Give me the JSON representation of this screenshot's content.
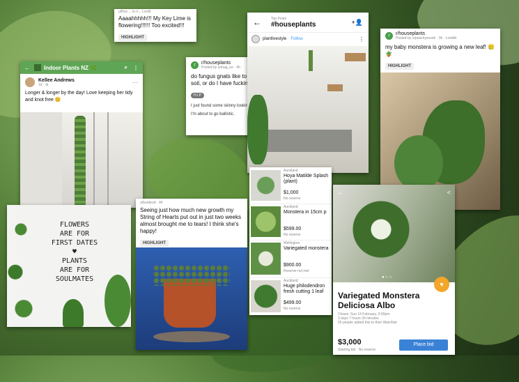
{
  "c1": {
    "meta": "u/Ros ... in r/... Lordit",
    "text": "Aaaahhhhh!!! My Key Lime is flowering!!!!!! Too excited!!!",
    "badge": "HIGHLIGHT"
  },
  "c2": {
    "group": "Indoor Plants NZ 🌿",
    "author": "Kellee Andrews",
    "time": "1d · ⚙",
    "text": "Longer & longer by the day! Love keeping her tidy and knot free 😊"
  },
  "c3": {
    "sub": "r/houseplants",
    "meta": "Posted by u/mag_ee · 4h",
    "title": "do fungus gnats like to crawl around in the soil, or do I have fucking thrips?",
    "flair": "H.I.P",
    "body1": "I just found some skinny looking shits in my orbifolia soil.",
    "body2": "I'm about to go ballistic."
  },
  "c4": {
    "top": "Top Posts",
    "tag": "#houseplants",
    "account": "plantlivestyle",
    "follow": "Follow"
  },
  "c5": {
    "sub": "r/houseplants",
    "meta": "Posted by u/peachysosoh · 3h · Lreddit",
    "text": "my baby monstera is growing a new leaf! 🥲🪴",
    "badge": "HIGHLIGHT"
  },
  "c6": {
    "lines": [
      "FLOWERS",
      "ARE FOR",
      "FIRST DATES",
      "♥",
      "PLANTS",
      "ARE FOR",
      "SOULMATES"
    ]
  },
  "c7": {
    "meta": "u/burdeod · 4h",
    "text": "Seeing just how much new growth my String of Hearts put out in just two weeks almost brought me to tears! I think she's happy!",
    "badge": "HIGHLIGHT"
  },
  "c8": {
    "items": [
      {
        "loc": "Auckland",
        "title": "Hoya Matilde Splash (plant)",
        "price": "$1,000",
        "note": "No reserve"
      },
      {
        "loc": "Auckland",
        "title": "Monstera in 15cm p",
        "price": "$599.00",
        "note": "No reserve"
      },
      {
        "loc": "Wellington",
        "title": "Variegated monstera",
        "price": "$900.00",
        "note": "Reserve not met"
      },
      {
        "loc": "Auckland",
        "title": "Huge philodendron fresh cutting 1 leaf",
        "price": "$499.00",
        "note": "No reserve"
      }
    ]
  },
  "c9": {
    "title": "Variegated Monstera Deliciosa Albo",
    "closes": "Closes: Sun 14 February, 9:00pm",
    "left": "3 days 7 hours 39 minutes",
    "watch": "55 people added this to their Watchlist",
    "price": "$3,000",
    "sub": "Starting bid · No reserve",
    "button": "Place bid"
  }
}
